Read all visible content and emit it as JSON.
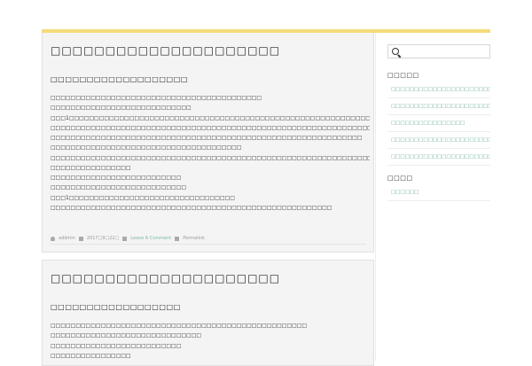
{
  "posts": [
    {
      "title": "□□□□□□□□□□□□□□□□□□□□□",
      "subtitle": "□□□□□□□□□□□□□□□□□□□",
      "lines": [
        "□□□□□□□□□□□□□□□□□□□□□□□□□□□□□□□□□□□□□□□□□□",
        "□□□□□□□□□□□□□□□□□□□□□□□□□□□□",
        "□□□1□□□□□□□□□□□□□□□□□□□□□□□□□□□□□□□□□□□□□□□□□□□□□□□□□□□□□□□□□□□□□□□□□□□□□□",
        "□□□□□□□□□□□□□□□□□□□□□□□□□□□□□□□□□□□□□□□□□□□□□□□□□□□□□□□□□□□□□□□□□□",
        "□□□□□□□□□□□□□□□□□□□□□□□□□□□□□□□□□□□□□□□□□□□□□□□□□□□□□□□□□□□□□□",
        "□□□□□□□□□□□□□□□□□□□□□□□□□□□□□□□□□□□□□□",
        "□□□□□□□□□□□□□□□□□□□□□□□□□□□□□□□□□□□□□□□□□□□□□□□□□□□□□□□□□□□□□□□□□□□□□□□□□□□□",
        "□□□□□□□□□□□□□□□□",
        "□□□□□□□□□□□□□□□□□□□□□□□□□□",
        "□□□□□□□□□□□□□□□□□□□□□□□□□□□",
        "□□□1□□□□□□□□□□□□□□□□□□□□□□□□□□□□□□□□□",
        "□□□□□□□□□□□□□□□□□□□□□□□□□□□□□□□□□□□□□□□□□□□□□□□□□□□□□□□□"
      ],
      "meta": {
        "author": "addmin",
        "date": "2017□9□22□",
        "comment_link": "Leave A Comment",
        "permalink": "Permalink"
      }
    },
    {
      "title": "□□□□□□□□□□□□□□□□□□□□□",
      "subtitle": "□□□□□□□□□□□□□□□□□□",
      "lines": [
        "□□□□□□□□□□□□□□□□□□□□□□□□□□□□□□□□□□□□□□□□□□□□□□□□□□□",
        "□□□□□□□□□□□□□□□□□□□□□□□□□□□□□□",
        "□□□□□□□□□□□□□□□□□□□□□□□□□□",
        "□□□□□□□□□□□□□□□□"
      ]
    }
  ],
  "sidebar": {
    "search": {
      "value": "",
      "placeholder": ""
    },
    "recent_title": "□□□□□",
    "recent_items": [
      "□□□□□□□□□□□□□□□□□□□□□□",
      "□□□□□□□□□□□□□□□□□□□□□□",
      "□□□□□□□□□□□□□□□□",
      "□□□□□□□□□□□□□□□□□□□□□□",
      "□□□□□□□□□□□□□□□□□□□□□□□□"
    ],
    "category_title": "□□□□",
    "category_items": [
      "□□□□□□"
    ]
  },
  "colors": {
    "accent_bar": "#f5dc7a",
    "link": "#6aa99a"
  }
}
